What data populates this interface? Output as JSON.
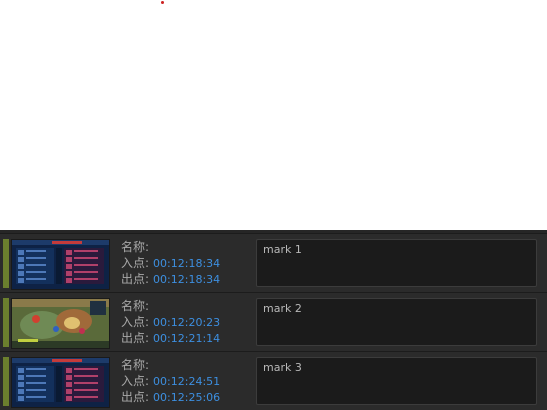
{
  "labels": {
    "name": "名称:",
    "in_point": "入点:",
    "out_point": "出点:"
  },
  "markers": [
    {
      "in": "00:12:18:34",
      "out": "00:12:18:34",
      "note": "mark 1",
      "thumb": "scoreboard"
    },
    {
      "in": "00:12:20:23",
      "out": "00:12:21:14",
      "note": "mark 2",
      "thumb": "battle"
    },
    {
      "in": "00:12:24:51",
      "out": "00:12:25:06",
      "note": "mark 3",
      "thumb": "scoreboard"
    }
  ],
  "colors": {
    "strip": "#6b7f2e",
    "timecode": "#3d8fe0",
    "panel": "#262626"
  }
}
